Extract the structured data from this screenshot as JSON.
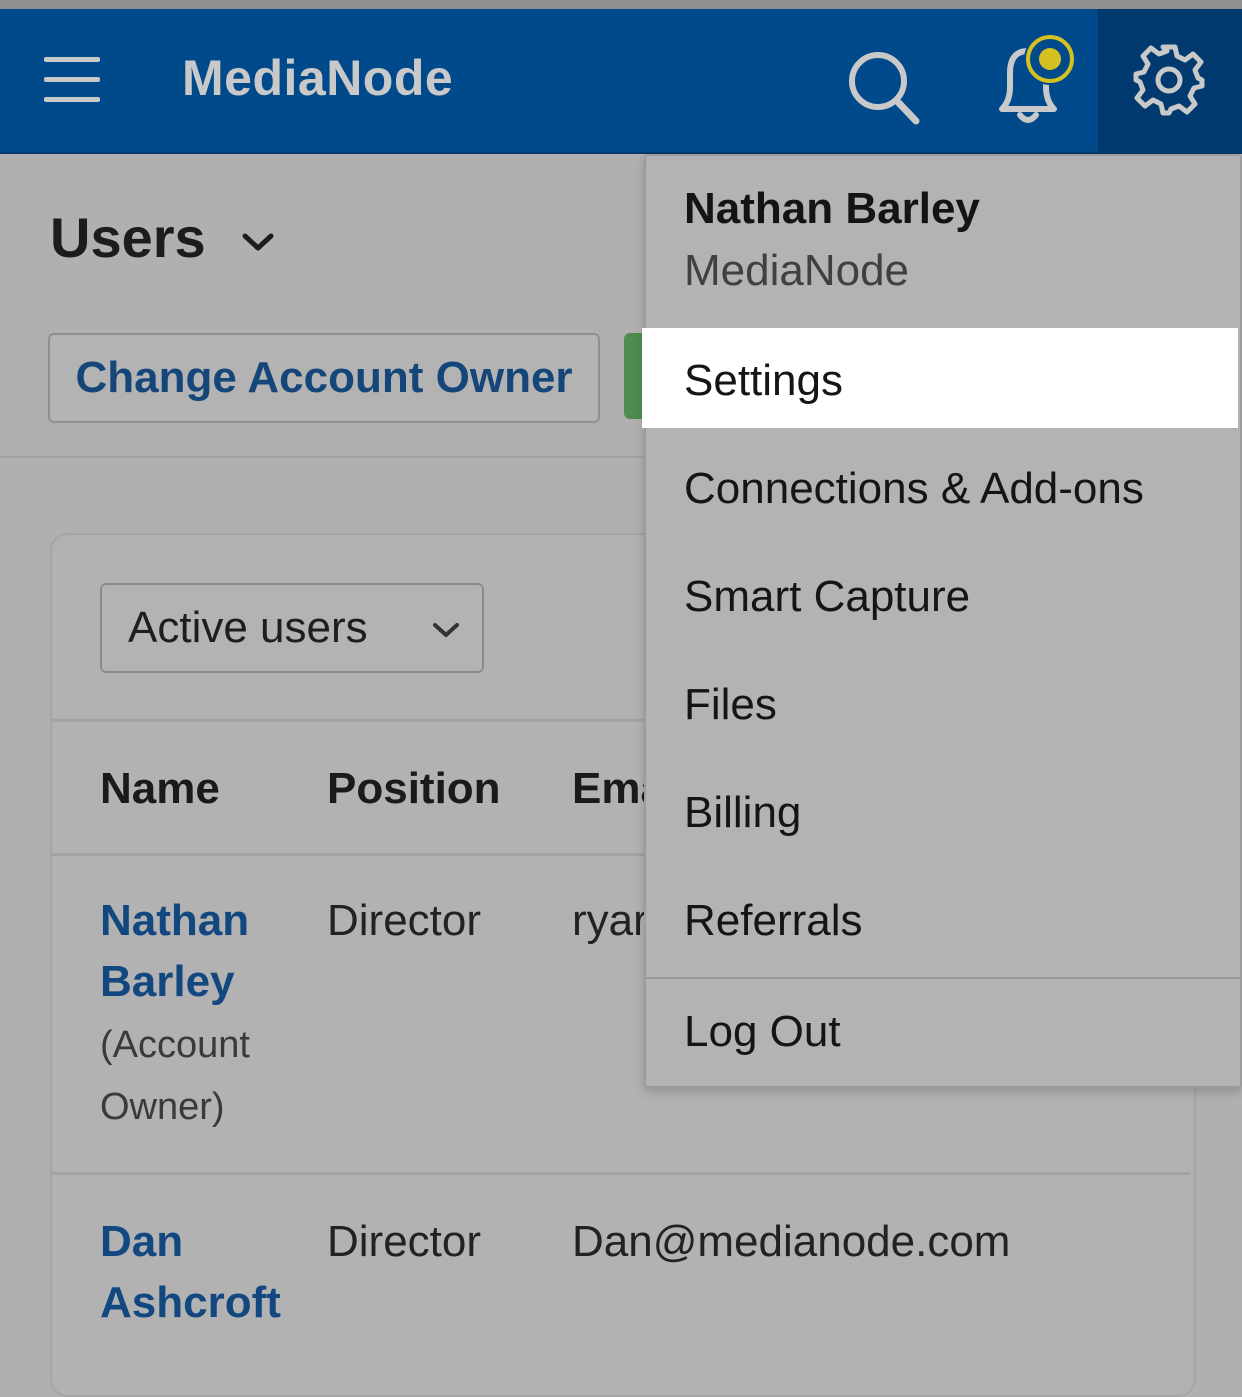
{
  "header": {
    "brand": "MediaNode"
  },
  "page": {
    "title": "Users",
    "change_owner_label": "Change Account Owner",
    "filter_value": "Active users"
  },
  "table": {
    "headers": [
      "Name",
      "Position",
      "Ema"
    ],
    "rows": [
      {
        "name_line1": "Nathan",
        "name_line2": "Barley",
        "note_line1": "(Account",
        "note_line2": "Owner)",
        "position": "Director",
        "email": "ryar"
      },
      {
        "name_line1": "Dan",
        "name_line2": "Ashcroft",
        "position": "Director",
        "email": "Dan@medianode.com"
      }
    ]
  },
  "dropdown": {
    "user_name": "Nathan Barley",
    "org_name": "MediaNode",
    "items": [
      "Settings",
      "Connections & Add-ons",
      "Smart Capture",
      "Files",
      "Billing",
      "Referrals"
    ],
    "logout": "Log Out",
    "highlighted": "Settings"
  },
  "colors": {
    "navbar": "#004a8b",
    "link": "#12477f",
    "notification_dot": "#d4c020",
    "highlight": "#ffffff"
  }
}
